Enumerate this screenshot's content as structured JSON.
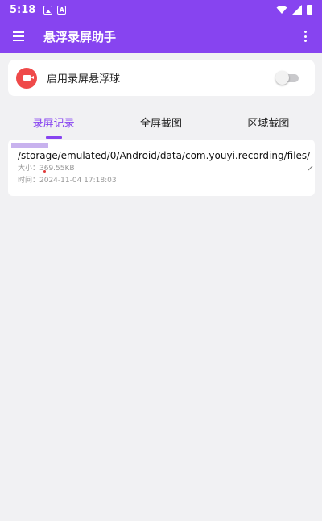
{
  "status_bar": {
    "time": "5:18",
    "icons": [
      "photo-icon",
      "a-icon",
      "wifi-icon",
      "signal-icon",
      "battery-icon"
    ]
  },
  "app_bar": {
    "title": "悬浮录屏助手",
    "icons": [
      "menu-icon",
      "more-vert-icon"
    ]
  },
  "toggle": {
    "label": "启用录屏悬浮球",
    "enabled": false,
    "icon": "video-record-icon"
  },
  "tabs": [
    {
      "label": "录屏记录",
      "active": true
    },
    {
      "label": "全屏截图",
      "active": false
    },
    {
      "label": "区域截图",
      "active": false
    }
  ],
  "files": [
    {
      "path": "/storage/emulated/0/Android/data/com.youyi.recording/files/",
      "size": "大小：369.55KB",
      "time": "时间：2024-11-04 17:18:03"
    }
  ],
  "colors": {
    "accent": "#8744f0",
    "record_red": "#ef4a4a",
    "background": "#f1f1f3"
  }
}
